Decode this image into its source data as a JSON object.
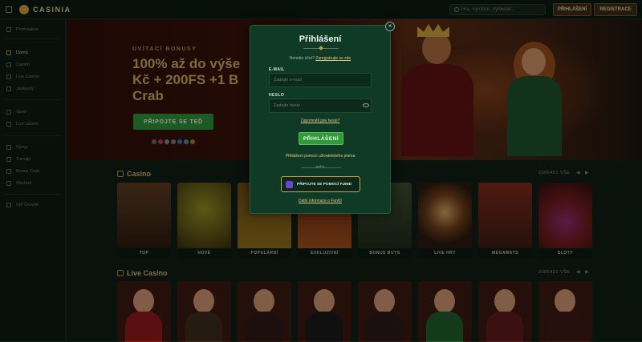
{
  "app": {
    "brand": "CASINIA"
  },
  "topbar": {
    "search_placeholder": "Hra, Výrobce, Vyhledat...",
    "login_label": "PŘIHLÁŠENÍ",
    "register_label": "REGISTRACE"
  },
  "sidebar": {
    "items": [
      {
        "label": "Promoakce"
      },
      {
        "label": "Domů",
        "active": true
      },
      {
        "label": "Casino"
      },
      {
        "label": "Live Casino"
      },
      {
        "label": "Jackpoty"
      },
      {
        "label": "Sport"
      },
      {
        "label": "Live sázení"
      },
      {
        "label": "Výzvy"
      },
      {
        "label": "Turnaje"
      },
      {
        "label": "Bonus Crab"
      },
      {
        "label": "Obchod"
      },
      {
        "label": "VIP Úrovně"
      }
    ]
  },
  "hero": {
    "kicker": "UVÍTACÍ BONUSY",
    "title_line1": "100% až do výše",
    "title_line2": "Kč + 200FS +1 B",
    "title_line3": "Crab",
    "cta": "PŘIPOJTE SE TEĎ"
  },
  "casino": {
    "title": "Casino",
    "count": "2086421",
    "all": "VŠE",
    "tiles": [
      "TOP",
      "NOVÉ",
      "POPULÁRNÍ",
      "EXKLUZIVNÍ",
      "BONUS BUYS",
      "LIVE HRY",
      "MEGAWAYS",
      "SLOTY"
    ]
  },
  "live_casino": {
    "title": "Live Casino",
    "count": "2086421",
    "all": "VŠE"
  },
  "login_modal": {
    "title": "Přihlášení",
    "no_account": "Nemáte účet?",
    "register_link": "Zaregistrujte se zde",
    "email_label": "E-MAIL",
    "email_placeholder": "Zadejte e-mail",
    "password_label": "HESLO",
    "password_placeholder": "Zadejte heslo",
    "forgot": "Zapomněli jste heslo?",
    "submit": "PŘIHLÁŠENÍ",
    "username_login": "Přihlášení pomocí uživatelského jména",
    "or": "nebo",
    "funid_button": "PŘIPOJTE SE POMOCÍ FUNID",
    "funid_more": "Další informace o FunID"
  },
  "colors": {
    "accent_gold": "#c69a3a",
    "modal_bg": "#0f3a26",
    "cta_green": "#2f9a3a"
  }
}
